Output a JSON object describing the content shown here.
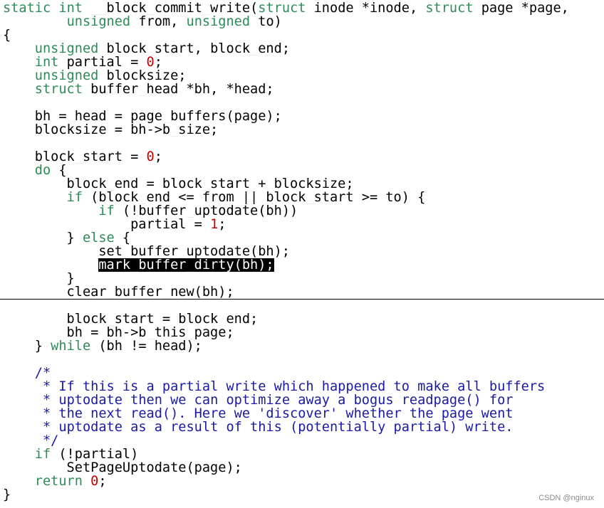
{
  "colors": {
    "keyword": "#2e8b57",
    "number": "#cc0000",
    "comment": "#1a1aa6",
    "selection_bg": "#000000",
    "selection_fg": "#ffffff"
  },
  "code_lines": [
    [
      [
        "kw",
        "static"
      ],
      [
        "t",
        " "
      ],
      [
        "kw",
        "int"
      ],
      [
        "t",
        " __block_commit_write("
      ],
      [
        "kw",
        "struct"
      ],
      [
        "t",
        " inode *inode, "
      ],
      [
        "kw",
        "struct"
      ],
      [
        "t",
        " page *page,"
      ]
    ],
    [
      [
        "t",
        "        "
      ],
      [
        "kw",
        "unsigned"
      ],
      [
        "t",
        " from, "
      ],
      [
        "kw",
        "unsigned"
      ],
      [
        "t",
        " to)"
      ]
    ],
    [
      [
        "t",
        "{"
      ]
    ],
    [
      [
        "t",
        "    "
      ],
      [
        "kw",
        "unsigned"
      ],
      [
        "t",
        " block_start, block_end;"
      ]
    ],
    [
      [
        "t",
        "    "
      ],
      [
        "kw",
        "int"
      ],
      [
        "t",
        " partial = "
      ],
      [
        "num",
        "0"
      ],
      [
        "t",
        ";"
      ]
    ],
    [
      [
        "t",
        "    "
      ],
      [
        "kw",
        "unsigned"
      ],
      [
        "t",
        " blocksize;"
      ]
    ],
    [
      [
        "t",
        "    "
      ],
      [
        "kw",
        "struct"
      ],
      [
        "t",
        " buffer_head *bh, *head;"
      ]
    ],
    [],
    [
      [
        "t",
        "    bh = head = page_buffers(page);"
      ]
    ],
    [
      [
        "t",
        "    blocksize = bh->b_size;"
      ]
    ],
    [],
    [
      [
        "t",
        "    block_start = "
      ],
      [
        "num",
        "0"
      ],
      [
        "t",
        ";"
      ]
    ],
    [
      [
        "t",
        "    "
      ],
      [
        "kw",
        "do"
      ],
      [
        "t",
        " {"
      ]
    ],
    [
      [
        "t",
        "        block_end = block_start + blocksize;"
      ]
    ],
    [
      [
        "t",
        "        "
      ],
      [
        "kw",
        "if"
      ],
      [
        "t",
        " (block_end <= from || block_start >= to) {"
      ]
    ],
    [
      [
        "t",
        "            "
      ],
      [
        "kw",
        "if"
      ],
      [
        "t",
        " (!buffer_uptodate(bh))"
      ]
    ],
    [
      [
        "t",
        "                partial = "
      ],
      [
        "num",
        "1"
      ],
      [
        "t",
        ";"
      ]
    ],
    [
      [
        "t",
        "        } "
      ],
      [
        "kw",
        "else"
      ],
      [
        "t",
        " {"
      ]
    ],
    [
      [
        "t",
        "            set_buffer_uptodate(bh);"
      ]
    ],
    [
      [
        "t",
        "            "
      ],
      [
        "sel",
        "mark_buffer_dirty(bh);"
      ]
    ],
    [
      [
        "t",
        "        }"
      ]
    ],
    [
      [
        "t",
        "        clear_buffer_new(bh);"
      ]
    ],
    [],
    [
      [
        "t",
        "        block_start = block_end;"
      ]
    ],
    [
      [
        "t",
        "        bh = bh->b_this_page;"
      ]
    ],
    [
      [
        "t",
        "    } "
      ],
      [
        "kw",
        "while"
      ],
      [
        "t",
        " (bh != head);"
      ]
    ],
    [],
    [
      [
        "t",
        "    "
      ],
      [
        "cmt",
        "/*"
      ]
    ],
    [
      [
        "t",
        "     "
      ],
      [
        "cmt",
        "* If this is a partial write which happened to make all buffers"
      ]
    ],
    [
      [
        "t",
        "     "
      ],
      [
        "cmt",
        "* uptodate then we can optimize away a bogus readpage() for"
      ]
    ],
    [
      [
        "t",
        "     "
      ],
      [
        "cmt",
        "* the next read(). Here we 'discover' whether the page went"
      ]
    ],
    [
      [
        "t",
        "     "
      ],
      [
        "cmt",
        "* uptodate as a result of this (potentially partial) write."
      ]
    ],
    [
      [
        "t",
        "     "
      ],
      [
        "cmt",
        "*/"
      ]
    ],
    [
      [
        "t",
        "    "
      ],
      [
        "kw",
        "if"
      ],
      [
        "t",
        " (!partial)"
      ]
    ],
    [
      [
        "t",
        "        SetPageUptodate(page);"
      ]
    ],
    [
      [
        "t",
        "    "
      ],
      [
        "kw",
        "return"
      ],
      [
        "t",
        " "
      ],
      [
        "num",
        "0"
      ],
      [
        "t",
        ";"
      ]
    ],
    [
      [
        "t",
        "}"
      ]
    ]
  ],
  "watermark": "CSDN @nginux"
}
